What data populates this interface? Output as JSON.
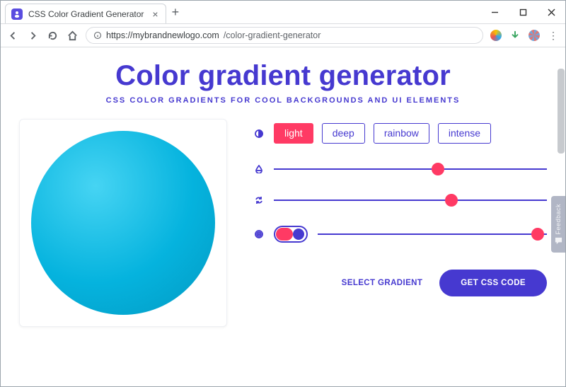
{
  "browser": {
    "tab_title": "CSS Color Gradient Generator",
    "url_host": "https://mybrandnewlogo.com",
    "url_path": "/color-gradient-generator"
  },
  "hero": {
    "title": "Color gradient generator",
    "subtitle": "CSS color gradients for cool backgrounds and UI elements"
  },
  "modes": {
    "active": "light",
    "options": [
      "light",
      "deep",
      "rainbow",
      "intense"
    ]
  },
  "sliders": {
    "hue": 60,
    "rotate": 65,
    "spread": 96
  },
  "toggle": {
    "on": true
  },
  "actions": {
    "select": "SELECT GRADIENT",
    "cta": "GET CSS CODE"
  },
  "feedback": {
    "label": "Feedback"
  },
  "colors": {
    "primary": "#4639d0",
    "accent": "#ff3a64",
    "preview_from": "#46d4f3",
    "preview_to": "#049fc8"
  }
}
